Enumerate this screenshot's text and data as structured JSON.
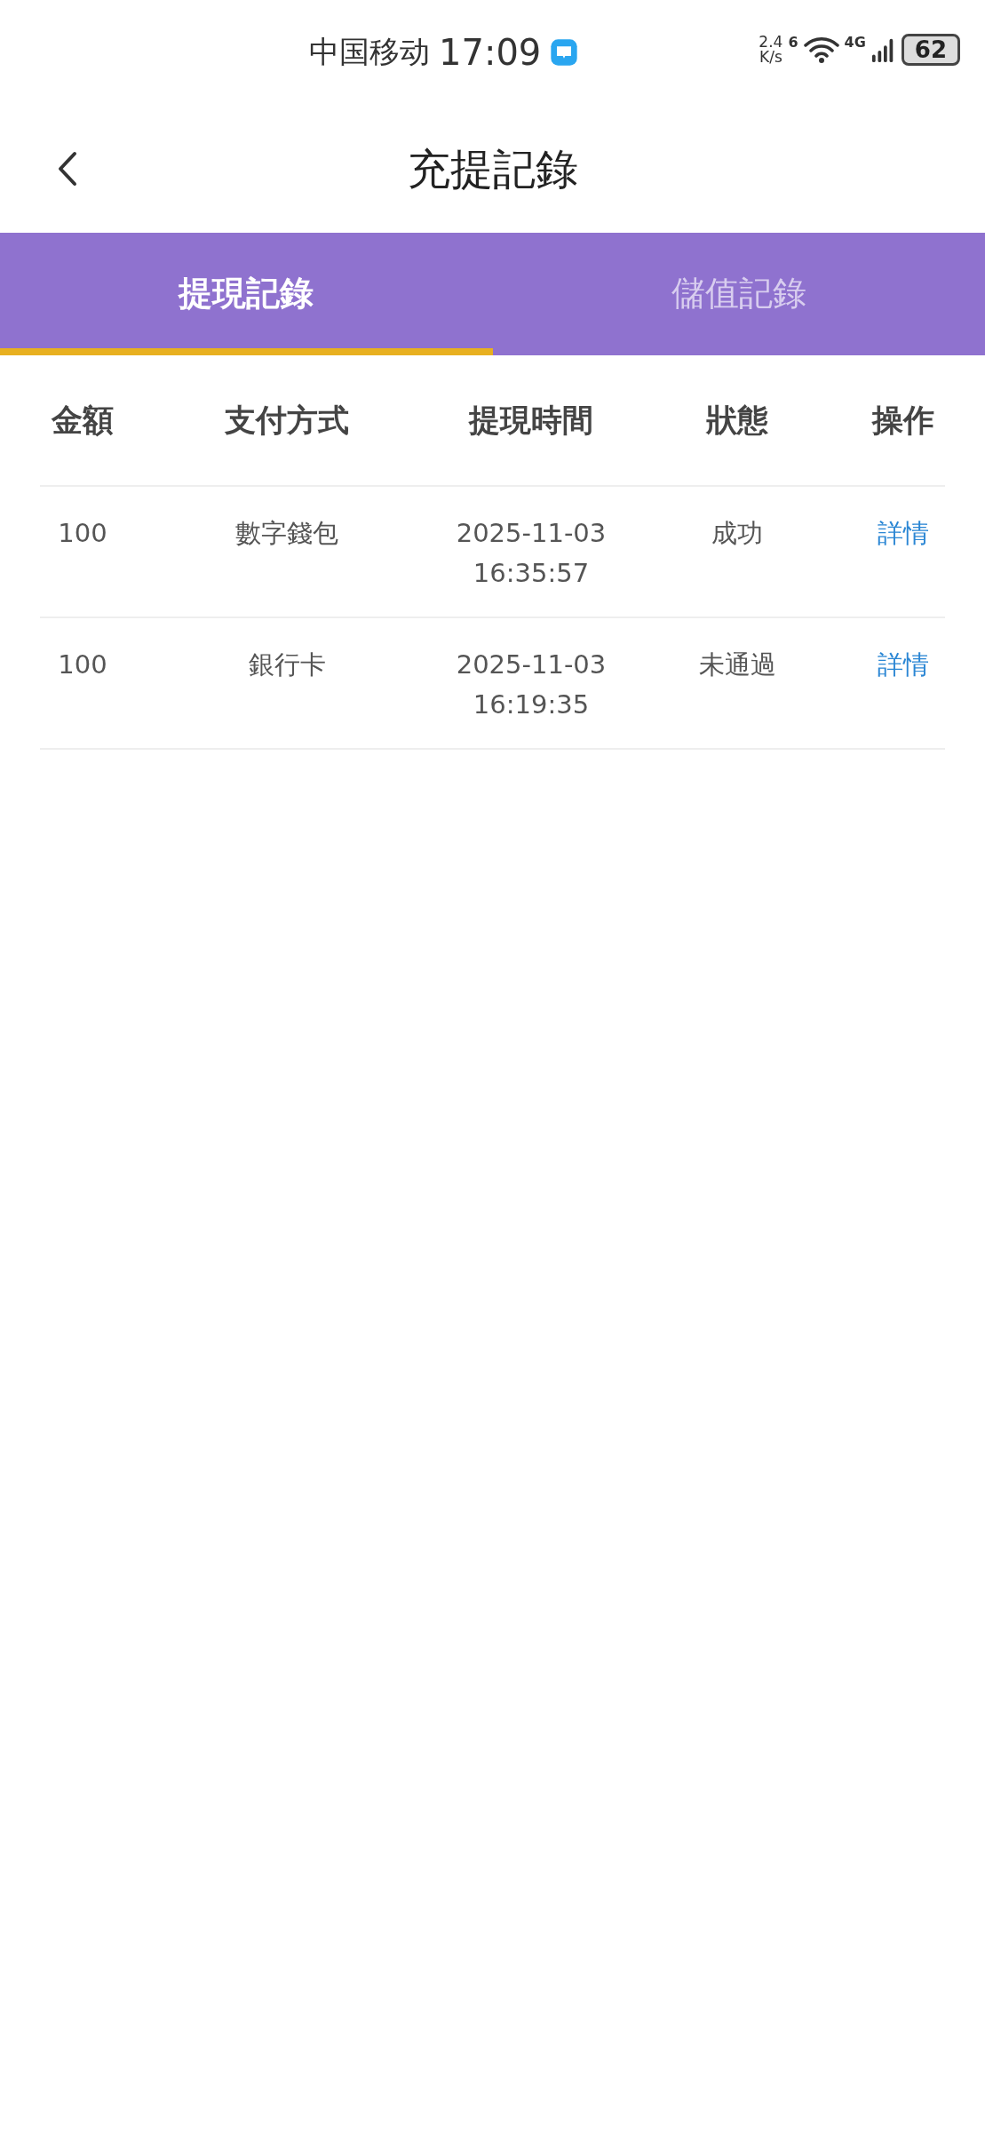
{
  "status_bar": {
    "carrier": "中国移动",
    "time": "17:09",
    "speed_value": "2.4",
    "speed_unit": "K/s",
    "wifi_badge": "6",
    "network": "4G",
    "battery": "62"
  },
  "header": {
    "title": "充提記錄"
  },
  "tabs": [
    {
      "label": "提現記錄",
      "selected": true
    },
    {
      "label": "儲值記錄",
      "selected": false
    }
  ],
  "table": {
    "columns": [
      "金額",
      "支付方式",
      "提現時間",
      "狀態",
      "操作"
    ],
    "rows": [
      {
        "amount": "100",
        "method": "數字錢包",
        "date": "2025-11-03",
        "time": "16:35:57",
        "status": "成功",
        "action": "詳情"
      },
      {
        "amount": "100",
        "method": "銀行卡",
        "date": "2025-11-03",
        "time": "16:19:35",
        "status": "未通過",
        "action": "詳情"
      }
    ]
  }
}
